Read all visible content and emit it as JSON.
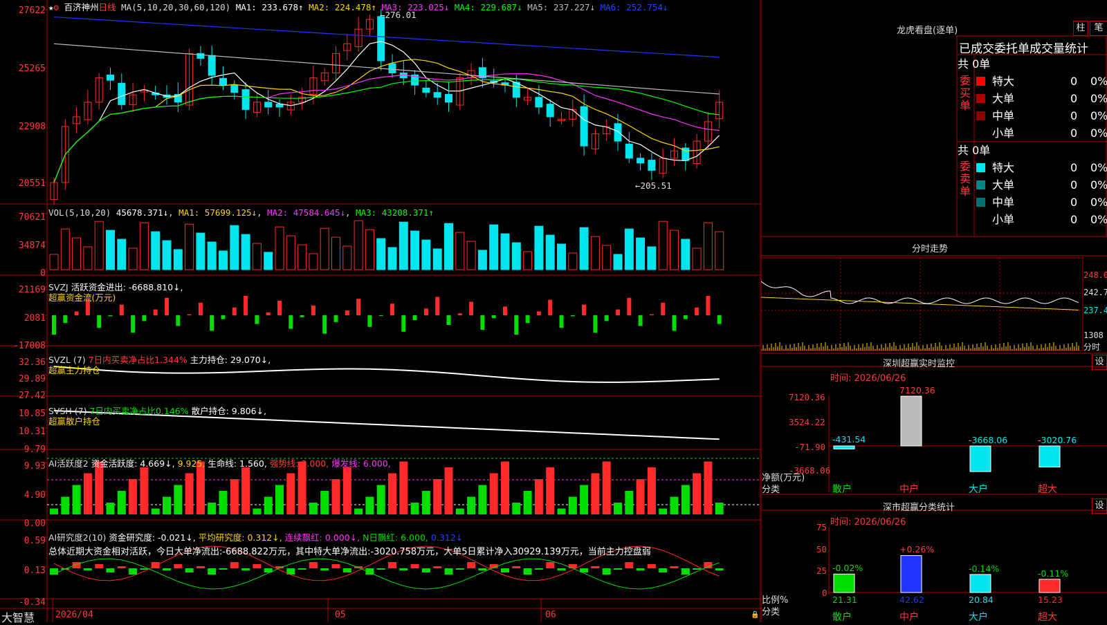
{
  "colors": {
    "up": "#ff2a2a",
    "down": "#00e5ee",
    "ma1": "#ffffff",
    "ma2": "#ffd400",
    "ma3": "#ff33ff",
    "ma4": "#00ff00",
    "ma5": "#bbbbbb",
    "ma6": "#2233ff",
    "axis": "#b00000",
    "green": "#00dd00",
    "magenta": "#ff33ff"
  },
  "stock": {
    "name": "百济神州",
    "period": "日线",
    "ma_label": "MA(5,10,20,30,60,120)"
  },
  "ma_values": {
    "ma1": "MA1: 233.678↑",
    "ma2": "MA2: 224.478↑",
    "ma3": "MA3: 223.025↓",
    "ma4": "MA4: 229.687↓",
    "ma5": "MA5: 237.227↓",
    "ma6": "MA6: 252.754↓"
  },
  "price_axis": [
    "27622",
    "25265",
    "22908",
    "20551"
  ],
  "price_marks": {
    "high": "276.01",
    "low": "205.51"
  },
  "vol": {
    "label": "VOL(5,10,20)",
    "value": "45678.371↓",
    "ma1": "MA1: 57699.125↓",
    "ma2": "MA2: 47584.645↓",
    "ma3": "MA3: 43208.371↑",
    "axis": [
      "70621",
      "34874",
      "0"
    ]
  },
  "svzj": {
    "label": "SVZJ",
    "title": "活跃资金进出: -6688.810↓,",
    "sub": "超赢资金流(万元)",
    "axis": [
      "21169",
      "2081",
      "-17008"
    ]
  },
  "svzl": {
    "label": "SVZL (7)",
    "ratio": "7日内买卖净占比1.344%",
    "hold": "主力持仓: 29.070↓,",
    "sub": "超赢主力持仓",
    "axis": [
      "32.36",
      "29.89",
      "27.42"
    ]
  },
  "svsh": {
    "label": "SVSH (7)",
    "ratio": "7日内买卖净占比0.146%",
    "hold": "散户持仓: 9.806↓,",
    "sub": "超赢散户持仓",
    "axis": [
      "10.85",
      "10.31",
      "9.79"
    ]
  },
  "ai1": {
    "label": "AI活跃度2",
    "t1": "资金活跃度: 4.669↓,",
    "t2": "9.925,",
    "t3": "生命线: 1.560,",
    "t4": "强势线: 3.000,",
    "t5": "爆发线: 6.000,",
    "axis": [
      "9.93",
      "4.90",
      "0.00"
    ]
  },
  "ai2": {
    "label": "AI研究度2(10)",
    "t1": "资金研究度: -0.021↓,",
    "t2": "平均研究度: 0.312↓,",
    "t3": "连续飘红: 0.000↓,",
    "t4": "N日飘红: 6.000,",
    "t5": "0.312↓",
    "summary": "总体近期大资金相对活跃，今日大单净流出:-6688.822万元，其中特大单净流出:-3020.758万元，大单5日累计净入30929.139万元，当前主力控盘弱",
    "axis": [
      "0.59",
      "0.13",
      "-0.34"
    ]
  },
  "xaxis": {
    "d1": "2026/04",
    "d2": "05",
    "d3": "06"
  },
  "brand": "大智慧",
  "lhb": {
    "title": "龙虎看盘(逐单)",
    "btn1": "柱",
    "btn2": "笔",
    "header": "已成交委托单成交量统计",
    "buy": {
      "side": "委买单",
      "total": "共 0单",
      "rows": [
        {
          "name": "特大",
          "v": "0",
          "p": "0%",
          "c": "#ff0000"
        },
        {
          "name": "大单",
          "v": "0",
          "p": "0%",
          "c": "#aa0000"
        },
        {
          "name": "中单",
          "v": "0",
          "p": "0%",
          "c": "#880000"
        },
        {
          "name": "小单",
          "v": "0",
          "p": "0%",
          "c": "#000000"
        }
      ]
    },
    "sell": {
      "side": "委卖单",
      "total": "共 0单",
      "rows": [
        {
          "name": "特大",
          "v": "0",
          "p": "0%",
          "c": "#00e5ee"
        },
        {
          "name": "大单",
          "v": "0",
          "p": "0%",
          "c": "#008888"
        },
        {
          "name": "中单",
          "v": "0",
          "p": "0%",
          "c": "#007070"
        },
        {
          "name": "小单",
          "v": "0",
          "p": "0%",
          "c": "#000000"
        }
      ]
    }
  },
  "fenshi": {
    "title": "分时走势",
    "axis": [
      "248.0",
      "242.7",
      "237.4",
      "1308"
    ],
    "unit": "分时"
  },
  "monitor": {
    "title": "深圳超赢实时监控",
    "btn": "设",
    "time": "时间: 2026/06/26",
    "axis": [
      "7120.36",
      "3524.22",
      "-71.90",
      "-3668.06"
    ],
    "ylabel": "净额(万元)",
    "xlabel": "分类",
    "cats": [
      "散户",
      "中户",
      "大户",
      "超大"
    ],
    "vals": [
      "-431.54",
      "7120.36",
      "-3668.06",
      "-3020.76"
    ]
  },
  "classify": {
    "title": "深市超赢分类统计",
    "btn": "设",
    "time": "时间: 2026/06/26",
    "axis": [
      "75",
      "50",
      "25",
      "0"
    ],
    "ylabel": "比例%",
    "xlabel": "分类",
    "cats": [
      "散户",
      "中户",
      "大户",
      "超大"
    ],
    "pcts": [
      "-0.02%",
      "+0.26%",
      "-0.14%",
      "-0.11%"
    ],
    "vals": [
      "21.31",
      "42.62",
      "20.84",
      "15.23"
    ]
  }
}
